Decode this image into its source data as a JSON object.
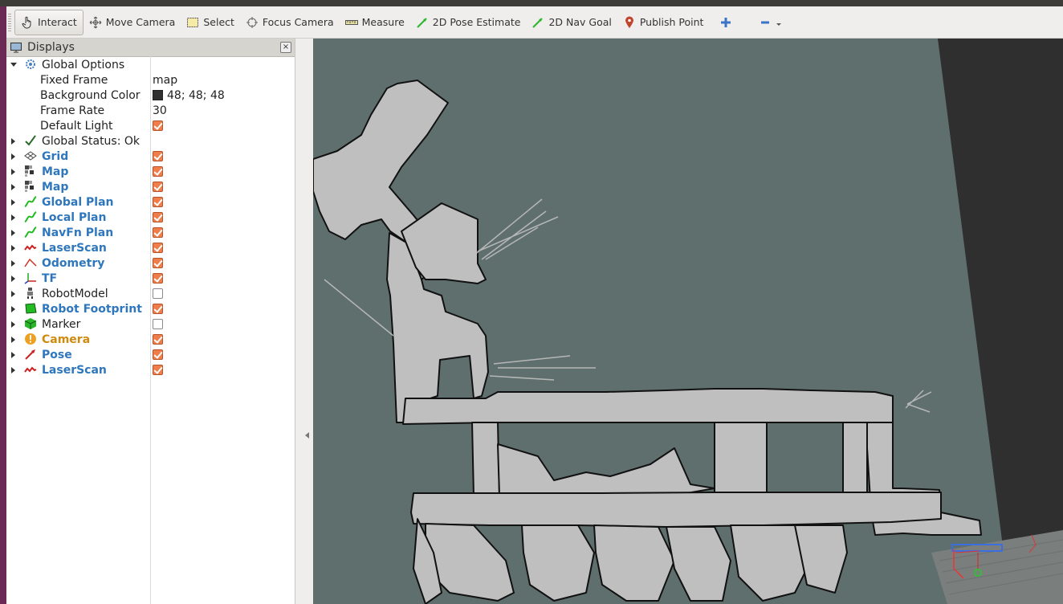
{
  "toolbar": {
    "items": [
      {
        "label": "Interact",
        "icon": "hand-pointer-icon"
      },
      {
        "label": "Move Camera",
        "icon": "move-camera-icon"
      },
      {
        "label": "Select",
        "icon": "select-box-icon"
      },
      {
        "label": "Focus Camera",
        "icon": "focus-camera-icon"
      },
      {
        "label": "Measure",
        "icon": "ruler-icon"
      },
      {
        "label": "2D Pose Estimate",
        "icon": "green-arrow-icon"
      },
      {
        "label": "2D Nav Goal",
        "icon": "green-arrow-icon"
      },
      {
        "label": "Publish Point",
        "icon": "map-pin-icon"
      }
    ]
  },
  "panel": {
    "title": "Displays",
    "global_options": {
      "label": "Global Options",
      "fixed_frame_label": "Fixed Frame",
      "fixed_frame_value": "map",
      "background_color_label": "Background Color",
      "background_color_value": "48; 48; 48",
      "frame_rate_label": "Frame Rate",
      "frame_rate_value": "30",
      "default_light_label": "Default Light"
    },
    "global_status": "Global Status: Ok",
    "displays": [
      {
        "label": "Grid",
        "checked": true,
        "style": "blue",
        "icon": "grid-icon"
      },
      {
        "label": "Map",
        "checked": true,
        "style": "blue",
        "icon": "map-icon"
      },
      {
        "label": "Map",
        "checked": true,
        "style": "blue",
        "icon": "map-icon"
      },
      {
        "label": "Global Plan",
        "checked": true,
        "style": "blue",
        "icon": "path-icon"
      },
      {
        "label": "Local Plan",
        "checked": true,
        "style": "blue",
        "icon": "path-icon"
      },
      {
        "label": "NavFn Plan",
        "checked": true,
        "style": "blue",
        "icon": "path-icon"
      },
      {
        "label": "LaserScan",
        "checked": true,
        "style": "blue",
        "icon": "laserscan-icon"
      },
      {
        "label": "Odometry",
        "checked": true,
        "style": "blue",
        "icon": "odometry-icon"
      },
      {
        "label": "TF",
        "checked": true,
        "style": "blue",
        "icon": "tf-axes-icon"
      },
      {
        "label": "RobotModel",
        "checked": false,
        "style": "plain",
        "icon": "robot-model-icon"
      },
      {
        "label": "Robot Footprint",
        "checked": true,
        "style": "blue",
        "icon": "footprint-icon"
      },
      {
        "label": "Marker",
        "checked": false,
        "style": "plain",
        "icon": "marker-cube-icon"
      },
      {
        "label": "Camera",
        "checked": true,
        "style": "orange",
        "icon": "warning-icon"
      },
      {
        "label": "Pose",
        "checked": true,
        "style": "blue",
        "icon": "pose-arrow-icon"
      },
      {
        "label": "LaserScan",
        "checked": true,
        "style": "blue",
        "icon": "laserscan-icon"
      }
    ]
  },
  "colors": {
    "viewport_bg": "#5f6f6d",
    "map_free": "#bfbfbf",
    "map_obstacle": "#111111",
    "checkbox_on": "#ef7e4b",
    "label_blue": "#2f77bd",
    "label_orange": "#d08a0f"
  }
}
